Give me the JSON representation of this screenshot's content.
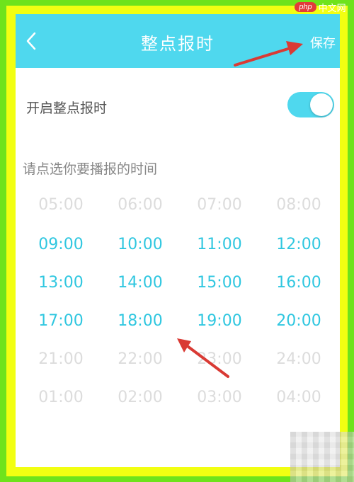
{
  "watermark": {
    "badge": "php",
    "text": "中文网"
  },
  "header": {
    "title": "整点报时",
    "save_label": "保存",
    "back_icon": "chevron-left-icon"
  },
  "toggle_row": {
    "label": "开启整点报时",
    "enabled": true
  },
  "prompt": "请点选你要播报的时间",
  "times": [
    {
      "label": "05:00",
      "selected": false
    },
    {
      "label": "06:00",
      "selected": false
    },
    {
      "label": "07:00",
      "selected": false
    },
    {
      "label": "08:00",
      "selected": false
    },
    {
      "label": "09:00",
      "selected": true
    },
    {
      "label": "10:00",
      "selected": true
    },
    {
      "label": "11:00",
      "selected": true
    },
    {
      "label": "12:00",
      "selected": true
    },
    {
      "label": "13:00",
      "selected": true
    },
    {
      "label": "14:00",
      "selected": true
    },
    {
      "label": "15:00",
      "selected": true
    },
    {
      "label": "16:00",
      "selected": true
    },
    {
      "label": "17:00",
      "selected": true
    },
    {
      "label": "18:00",
      "selected": true
    },
    {
      "label": "19:00",
      "selected": true
    },
    {
      "label": "20:00",
      "selected": true
    },
    {
      "label": "21:00",
      "selected": false
    },
    {
      "label": "22:00",
      "selected": false
    },
    {
      "label": "23:00",
      "selected": false
    },
    {
      "label": "24:00",
      "selected": false
    },
    {
      "label": "01:00",
      "selected": false
    },
    {
      "label": "02:00",
      "selected": false
    },
    {
      "label": "03:00",
      "selected": false
    },
    {
      "label": "04:00",
      "selected": false
    }
  ],
  "colors": {
    "accent": "#4fd8ee",
    "selected_text": "#30c7e0",
    "unselected_text": "#dcdcdc",
    "annotation_arrow": "#d93a34"
  }
}
